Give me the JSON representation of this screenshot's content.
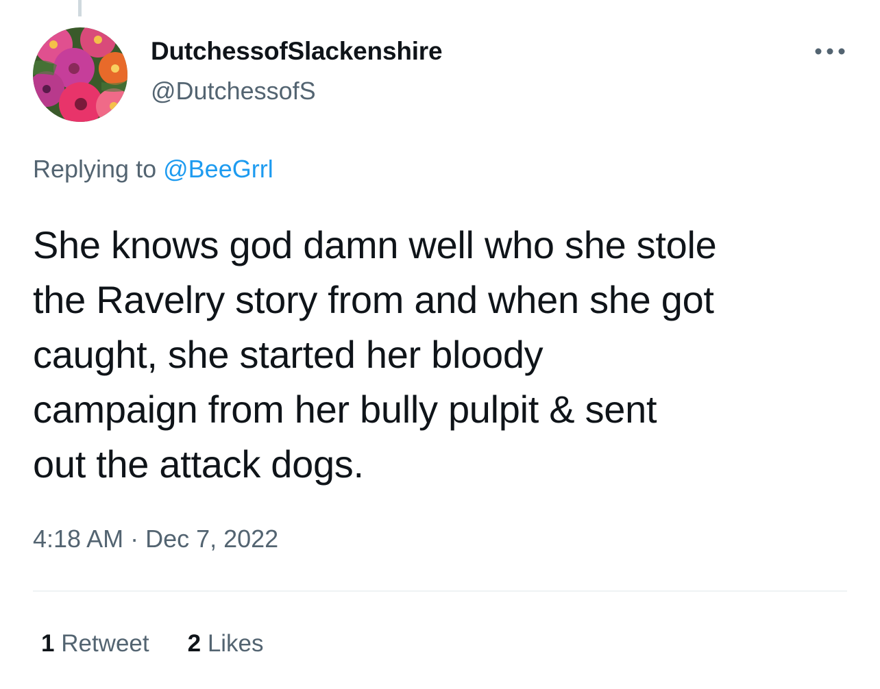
{
  "tweet": {
    "author": {
      "display_name": "DutchessofSlackenshire",
      "handle": "@DutchessofS"
    },
    "replying_prefix": "Replying to",
    "replying_to": "@BeeGrrl",
    "text_lines": [
      "She knows god damn well who she stole",
      "the Ravelry story from and when she got",
      "caught, she started her bloody",
      "campaign from her bully pulpit & sent",
      "out the attack dogs."
    ],
    "timestamp": "4:18 AM · Dec 7, 2022",
    "stats": {
      "retweets_count": "1",
      "retweets_label": "Retweet",
      "likes_count": "2",
      "likes_label": "Likes"
    }
  },
  "icons": {
    "more": "more-horizontal-icon",
    "avatar": "flower-avatar"
  },
  "colors": {
    "text_primary": "#0f1419",
    "text_secondary": "#536471",
    "link": "#1d9bf0",
    "divider": "#eff3f4"
  }
}
